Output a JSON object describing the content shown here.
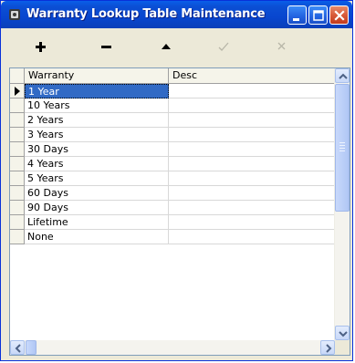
{
  "window": {
    "title": "Warranty Lookup Table Maintenance",
    "title_bar_color": "#0a4fd4"
  },
  "toolbar": {
    "add_icon": "plus-icon",
    "delete_icon": "minus-icon",
    "up_icon": "triangle-up-icon",
    "post_icon": "checkmark-icon",
    "cancel_icon": "x-icon"
  },
  "grid": {
    "columns": [
      "Warranty",
      "Desc"
    ],
    "rows": [
      {
        "warranty": "1 Year",
        "desc": ""
      },
      {
        "warranty": "10 Years",
        "desc": ""
      },
      {
        "warranty": "2 Years",
        "desc": ""
      },
      {
        "warranty": "3 Years",
        "desc": ""
      },
      {
        "warranty": "30 Days",
        "desc": ""
      },
      {
        "warranty": "4 Years",
        "desc": ""
      },
      {
        "warranty": "5 Years",
        "desc": ""
      },
      {
        "warranty": "60 Days",
        "desc": ""
      },
      {
        "warranty": "90 Days",
        "desc": ""
      },
      {
        "warranty": "Lifetime",
        "desc": ""
      },
      {
        "warranty": "None",
        "desc": ""
      }
    ],
    "selected_row": 0,
    "selection_color": "#316ac5"
  }
}
